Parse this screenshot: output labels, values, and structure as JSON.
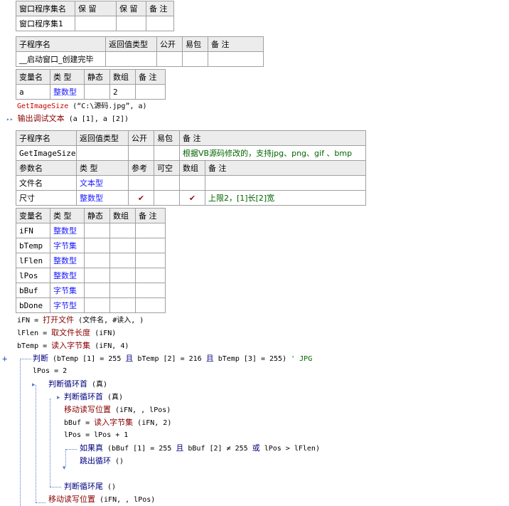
{
  "assembly_table": {
    "headers": [
      "窗口程序集名",
      "保 留",
      "保 留",
      "备 注"
    ],
    "row": [
      "窗口程序集1",
      "",
      "",
      ""
    ]
  },
  "sub1_table": {
    "headers": [
      "子程序名",
      "返回值类型",
      "公开",
      "易包",
      "备 注"
    ],
    "row": [
      "__启动窗口_创建完毕",
      "",
      "",
      "",
      ""
    ]
  },
  "var1_table": {
    "headers": [
      "变量名",
      "类 型",
      "静态",
      "数组",
      "备 注"
    ],
    "rows": [
      [
        "a",
        "整数型",
        "",
        "2",
        ""
      ]
    ]
  },
  "code1": {
    "line1_fn": "GetImageSize",
    "line1_args": " (“C:\\源码.jpg”, a)",
    "line2_marker": "▸▸",
    "line2_fn": "输出调试文本",
    "line2_args": " (a [1], a [2])"
  },
  "sub2_table": {
    "headers": [
      "子程序名",
      "返回值类型",
      "公开",
      "易包",
      "备 注"
    ],
    "row": [
      "GetImageSize",
      "",
      "",
      "",
      "根据VB源码修改的，支持jpg、png、gif 、bmp"
    ],
    "param_headers": [
      "参数名",
      "类 型",
      "参考",
      "可空",
      "数组",
      "备 注"
    ],
    "params": [
      [
        "文件名",
        "文本型",
        "",
        "",
        "",
        ""
      ],
      [
        "尺寸",
        "整数型",
        "✔",
        "",
        "✔",
        "上限2，[1]长[2]宽"
      ]
    ]
  },
  "var2_table": {
    "headers": [
      "变量名",
      "类 型",
      "静态",
      "数组",
      "备 注"
    ],
    "rows": [
      [
        "iFN",
        "整数型",
        "",
        "",
        ""
      ],
      [
        "bTemp",
        "字节集",
        "",
        "",
        ""
      ],
      [
        "lFlen",
        "整数型",
        "",
        "",
        ""
      ],
      [
        "lPos",
        "整数型",
        "",
        "",
        ""
      ],
      [
        "bBuf",
        "字节集",
        "",
        "",
        ""
      ],
      [
        "bDone",
        "字节型",
        "",
        "",
        ""
      ]
    ]
  },
  "code2": {
    "l1_a": "iFN = ",
    "l1_fn": "打开文件",
    "l1_b": " (文件名, #读入, )",
    "l2_a": "lFlen = ",
    "l2_fn": "取文件长度",
    "l2_b": " (iFN)",
    "l3_a": "bTemp = ",
    "l3_fn": "读入字节集",
    "l3_b": " (iFN, 4)",
    "l4_plus": "+",
    "l4_kw": "判断",
    "l4_a": " (bTemp [1] = 255 ",
    "l4_and1": "且",
    "l4_b": " bTemp [2] = 216 ",
    "l4_and2": "且",
    "l4_c": " bTemp [3] = 255)",
    "l4_cmt": "  ' JPG",
    "l5": "lPos = 2",
    "l6_kw": "判断循环首",
    "l6_b": " (真)",
    "l7_kw": "判断循环首",
    "l7_b": " (真)",
    "l8_fn": "移动读写位置",
    "l8_b": " (iFN, , lPos)",
    "l9_a": "bBuf = ",
    "l9_fn": "读入字节集",
    "l9_b": " (iFN, 2)",
    "l10": "lPos = lPos + 1",
    "l11_kw": "如果真",
    "l11_a": " (bBuf [1] = 255 ",
    "l11_and": "且",
    "l11_b": " bBuf [2] ≠ 255 ",
    "l11_or": "或",
    "l11_c": " lPos > lFlen)",
    "l12_kw": "跳出循环",
    "l12_b": " ()",
    "l13_kw": "判断循环尾",
    "l13_b": " ()",
    "l14_fn": "移动读写位置",
    "l14_b": " (iFN, , lPos)"
  }
}
